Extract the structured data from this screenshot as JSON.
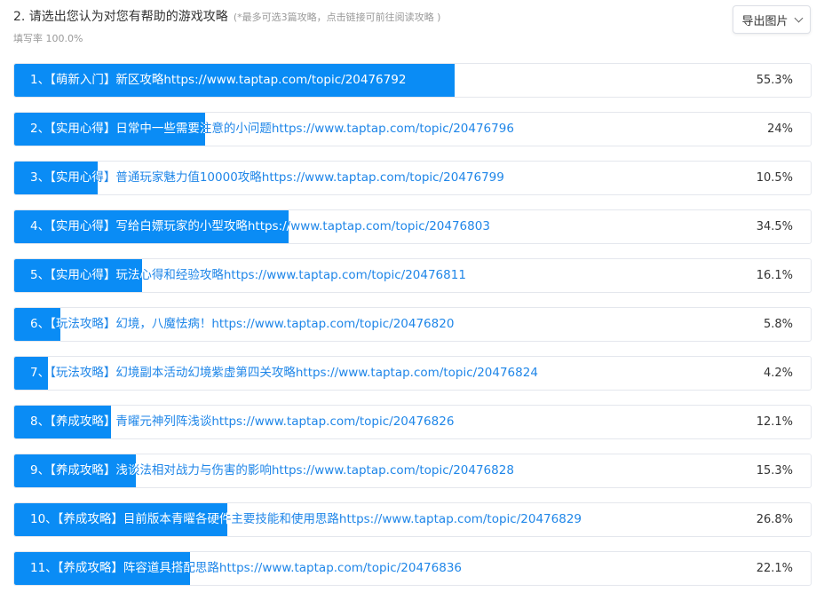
{
  "header": {
    "title": "2. 请选出您认为对您有帮助的游戏攻略",
    "note": "(*最多可选3篇攻略，点击链接可前往阅读攻略 )",
    "fill_rate": "填写率 100.0%",
    "export_label": "导出图片"
  },
  "colors": {
    "bar": "#0a8cf5",
    "link_text": "#1f86e8"
  },
  "chart_data": {
    "type": "bar",
    "orientation": "horizontal",
    "xlim": [
      0,
      100
    ],
    "unit": "%",
    "categories": [
      "1、【萌新入门】新区攻略https://www.taptap.com/topic/20476792",
      "2、【实用心得】日常中一些需要注意的小问题https://www.taptap.com/topic/20476796",
      "3、【实用心得】普通玩家魅力值10000攻略https://www.taptap.com/topic/20476799",
      "4、【实用心得】写给白嫖玩家的小型攻略https://www.taptap.com/topic/20476803",
      "5、【实用心得】玩法心得和经验攻略https://www.taptap.com/topic/20476811",
      "6、【玩法攻略】幻境，八魔怯病！https://www.taptap.com/topic/20476820",
      "7、【玩法攻略】幻境副本活动幻境紫虚第四关攻略https://www.taptap.com/topic/20476824",
      "8、【养成攻略】青曜元神列阵浅谈https://www.taptap.com/topic/20476826",
      "9、【养成攻略】浅谈法相对战力与伤害的影响https://www.taptap.com/topic/20476828",
      "10、【养成攻略】目前版本青曜各硬件主要技能和使用思路https://www.taptap.com/topic/20476829",
      "11、【养成攻略】阵容道具搭配思路https://www.taptap.com/topic/20476836"
    ],
    "values": [
      55.3,
      24,
      10.5,
      34.5,
      16.1,
      5.8,
      4.2,
      12.1,
      15.3,
      26.8,
      22.1
    ],
    "value_labels": [
      "55.3%",
      "24%",
      "10.5%",
      "34.5%",
      "16.1%",
      "5.8%",
      "4.2%",
      "12.1%",
      "15.3%",
      "26.8%",
      "22.1%"
    ]
  }
}
